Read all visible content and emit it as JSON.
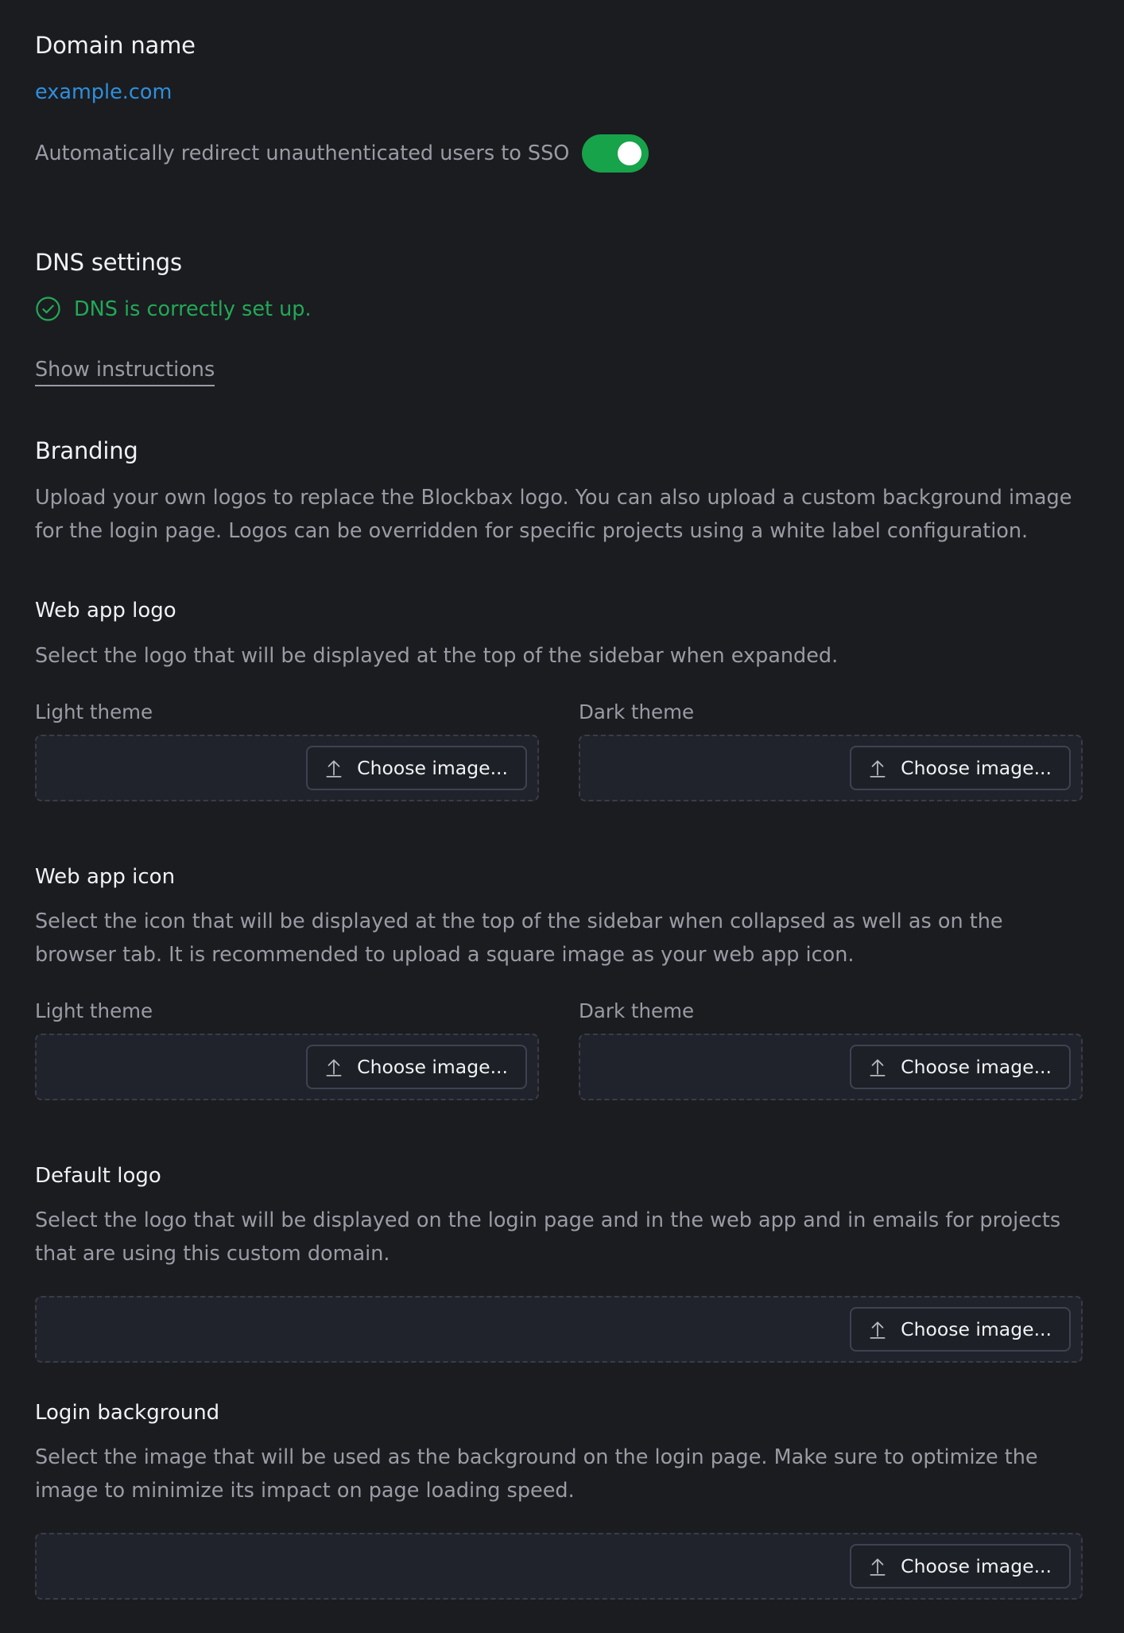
{
  "domain": {
    "heading": "Domain name",
    "value": "example.com",
    "sso_label": "Automatically redirect unauthenticated users to SSO",
    "sso_enabled": true
  },
  "dns": {
    "heading": "DNS settings",
    "status": "DNS is correctly set up.",
    "show_instructions": "Show instructions"
  },
  "branding": {
    "heading": "Branding",
    "description": "Upload your own logos to replace the Blockbax logo. You can also upload a custom background image for the login page. Logos can be overridden for specific projects using a white label configuration."
  },
  "web_app_logo": {
    "heading": "Web app logo",
    "description": "Select the logo that will be displayed at the top of the sidebar when expanded.",
    "light_label": "Light theme",
    "dark_label": "Dark theme"
  },
  "web_app_icon": {
    "heading": "Web app icon",
    "description": "Select the icon that will be displayed at the top of the sidebar when collapsed as well as on the browser tab. It is recommended to upload a square image as your web app icon.",
    "light_label": "Light theme",
    "dark_label": "Dark theme"
  },
  "default_logo": {
    "heading": "Default logo",
    "description": "Select the logo that will be displayed on the login page and in the web app and in emails for projects that are using this custom domain."
  },
  "login_background": {
    "heading": "Login background",
    "description": "Select the image that will be used as the background on the login page. Make sure to optimize the image to minimize its impact on page loading speed."
  },
  "choose_image_label": "Choose image...",
  "icons": {
    "status": "check-circle-icon",
    "upload": "upload-icon"
  },
  "colors": {
    "background": "#1b1c20",
    "link": "#2f8fdc",
    "success": "#22a957",
    "toggle_on": "#17a34a",
    "muted_text": "#9a9ca5"
  }
}
